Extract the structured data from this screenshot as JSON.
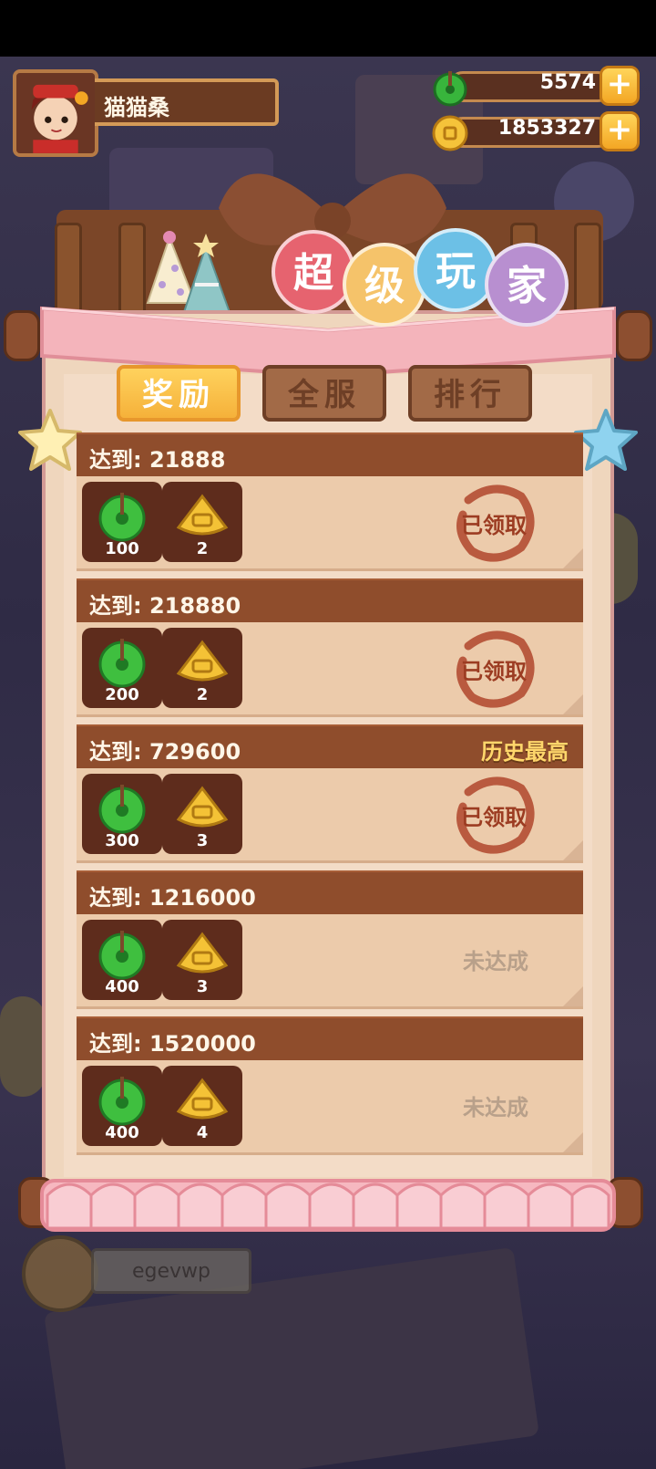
{
  "player": {
    "name": "猫猫桑",
    "jade": "5574",
    "coins": "1853327"
  },
  "title": [
    "超",
    "级",
    "玩",
    "家"
  ],
  "tabs": {
    "rewards": "奖励",
    "server": "全服",
    "ranking": "排行"
  },
  "rows": [
    {
      "target": "达到: 21888",
      "jade": "100",
      "tickets": "2",
      "status": "已领取",
      "claimed": true,
      "best": ""
    },
    {
      "target": "达到: 218880",
      "jade": "200",
      "tickets": "2",
      "status": "已领取",
      "claimed": true,
      "best": ""
    },
    {
      "target": "达到: 729600",
      "jade": "300",
      "tickets": "3",
      "status": "已领取",
      "claimed": true,
      "best": "历史最高"
    },
    {
      "target": "达到: 1216000",
      "jade": "400",
      "tickets": "3",
      "status": "未达成",
      "claimed": false,
      "best": ""
    },
    {
      "target": "达到: 1520000",
      "jade": "400",
      "tickets": "4",
      "status": "未达成",
      "claimed": false,
      "best": ""
    }
  ],
  "bottom": {
    "name": "egevwp"
  },
  "colors": {
    "title_balls": [
      "#e6636f",
      "#f5c36a",
      "#6cc0e6",
      "#b88fd0"
    ],
    "stars": [
      "#fff0b4",
      "#8fd3ef"
    ]
  }
}
